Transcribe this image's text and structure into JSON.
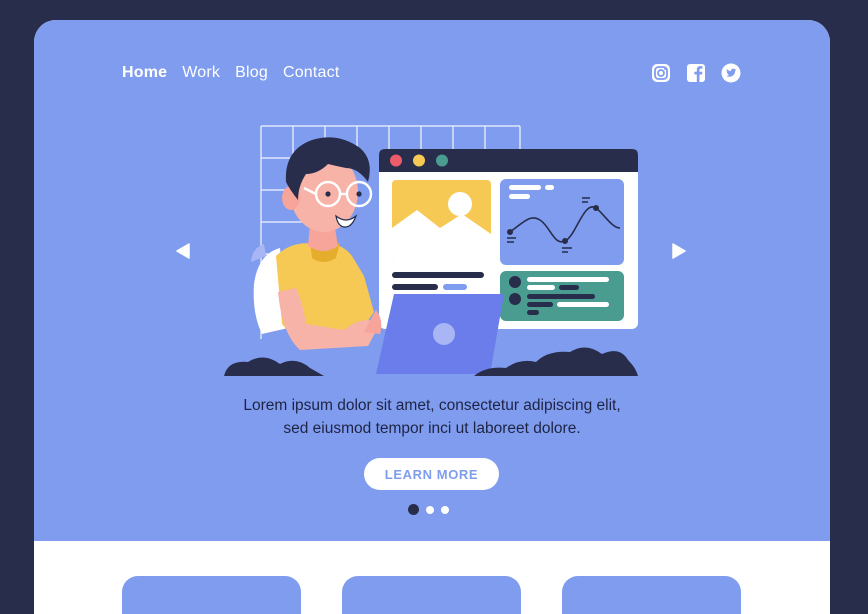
{
  "nav": {
    "items": [
      {
        "label": "Home",
        "active": true
      },
      {
        "label": "Work",
        "active": false
      },
      {
        "label": "Blog",
        "active": false
      },
      {
        "label": "Contact",
        "active": false
      }
    ]
  },
  "social": [
    "instagram-icon",
    "facebook-icon",
    "twitter-icon"
  ],
  "carousel": {
    "prev_icon": "triangle-left-icon",
    "next_icon": "triangle-right-icon",
    "slides": 3,
    "active_index": 0
  },
  "hero": {
    "line1": "Lorem ipsum dolor sit amet, consectetur adipiscing elit,",
    "line2": "sed eiusmod tempor inci ut laboreet dolore.",
    "cta_label": "LEARN MORE"
  },
  "colors": {
    "background": "#272d4b",
    "hero": "#7f9cef",
    "dark": "#272d4b",
    "white": "#ffffff"
  }
}
